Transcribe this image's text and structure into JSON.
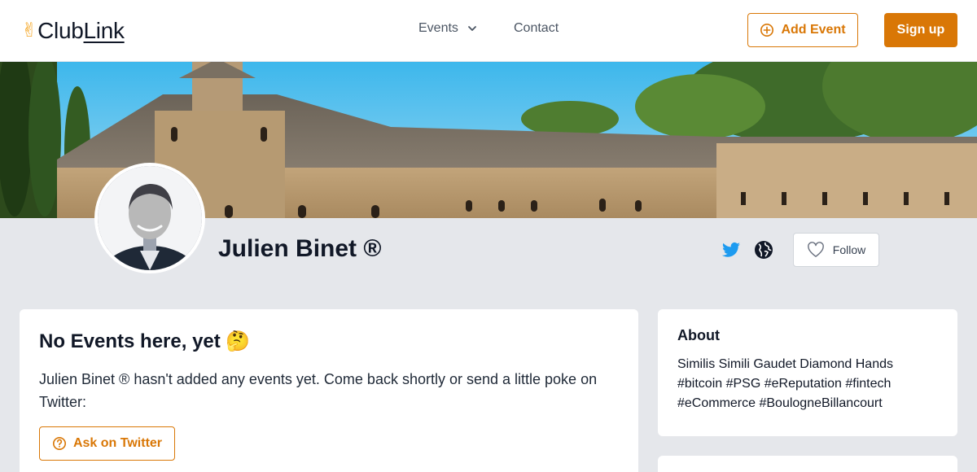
{
  "header": {
    "logo_hand": "✌",
    "logo_club": "Club",
    "logo_link": "Link",
    "nav_events": "Events",
    "nav_contact": "Contact",
    "add_event_label": "Add Event",
    "signup_label": "Sign up"
  },
  "profile": {
    "name": "Julien Binet ®",
    "follow_label": "Follow"
  },
  "events": {
    "empty_title": "No Events here, yet 🤔",
    "empty_text": "Julien Binet ® hasn't added any events yet. Come back shortly or send a little poke on Twitter:",
    "ask_label": "Ask on Twitter"
  },
  "about": {
    "title": "About",
    "text": "Similis Simili Gaudet Diamond Hands #bitcoin #PSG #eReputation #fintech #eCommerce #BoulogneBillancourt"
  },
  "colors": {
    "accent": "#d97706",
    "twitter": "#1d9bf0",
    "background": "#e5e7eb"
  },
  "icons": {
    "events_chevron": "chevron-down-icon",
    "add_event": "plus-circle-icon",
    "twitter": "twitter-icon",
    "website": "globe-icon",
    "follow": "heart-icon",
    "ask": "question-circle-icon"
  }
}
